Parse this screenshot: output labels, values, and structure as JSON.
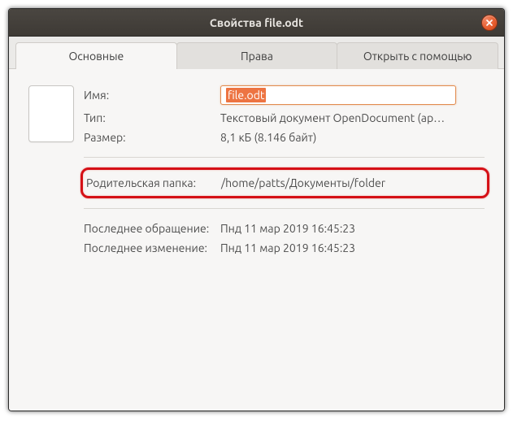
{
  "window": {
    "title": "Свойства file.odt"
  },
  "tabs": {
    "basic": "Основные",
    "permissions": "Права",
    "openwith": "Открыть с помощью"
  },
  "fields": {
    "name_label": "Имя:",
    "name_value": "file.odt",
    "type_label": "Тип:",
    "type_value": "Текстовый документ OpenDocument (ap…",
    "size_label": "Размер:",
    "size_value": "8,1 кБ (8.146 байт)",
    "parent_label": "Родительская папка:",
    "parent_value": "/home/patts/Документы/folder",
    "accessed_label": "Последнее обращение:",
    "accessed_value": "Пнд 11 мар 2019 16:45:23",
    "modified_label": "Последнее изменение:",
    "modified_value": "Пнд 11 мар 2019 16:45:23"
  }
}
